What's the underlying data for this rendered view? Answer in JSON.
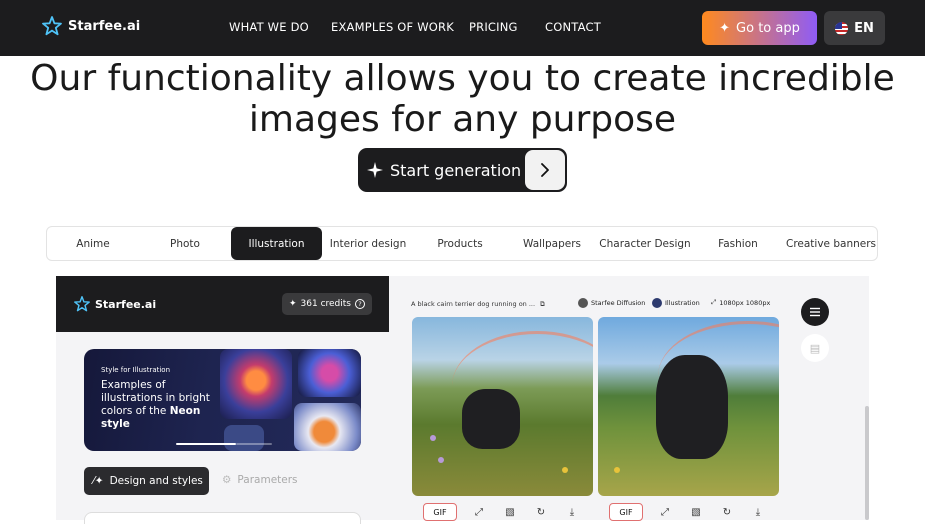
{
  "header": {
    "brand": "Starfee.ai",
    "nav": [
      "WHAT WE DO",
      "EXAMPLES OF WORK",
      "PRICING",
      "CONTACT"
    ],
    "go_to_app": "Go to app",
    "language": "EN"
  },
  "hero": {
    "line1": "Our functionality allows you to create incredible",
    "line2": "images for any purpose",
    "start_label": "Start generation"
  },
  "tabs": {
    "active": "Illustration",
    "items": [
      "Anime",
      "Photo",
      "Illustration",
      "Interior design",
      "Products",
      "Wallpapers",
      "Character Design",
      "Fashion",
      "Creative banners"
    ]
  },
  "app_preview": {
    "brand": "Starfee.ai",
    "credits": "361 credits",
    "banner": {
      "kicker": "Style for Illustration",
      "text_plain": "Examples of illustrations in bright colors of the",
      "text_bold1": "Neon",
      "text_bold2": "style"
    },
    "design_tab": "Design and styles",
    "params_tab": "Parameters",
    "prompt": "A black cairn terrier dog running on ...",
    "model": "Starfee Diffusion",
    "style": "Illustration",
    "size": "1080px 1080px",
    "gif_label": "GIF"
  },
  "icons": [
    "star-logo-icon",
    "sparkle-icon",
    "us-flag-icon",
    "chevron-right-icon",
    "help-icon",
    "magic-wand-icon",
    "gear-icon",
    "copy-icon",
    "expand-icon",
    "menu-icon",
    "document-icon",
    "maximize-icon",
    "crop-icon",
    "refresh-icon",
    "download-icon"
  ],
  "colors": {
    "topbar": "#1c1c1e",
    "accent_start": "#ff8a1e",
    "accent_end": "#8f5cf6",
    "active_tab": "#1c1c1e",
    "panel_bg": "#f4f4f6"
  }
}
